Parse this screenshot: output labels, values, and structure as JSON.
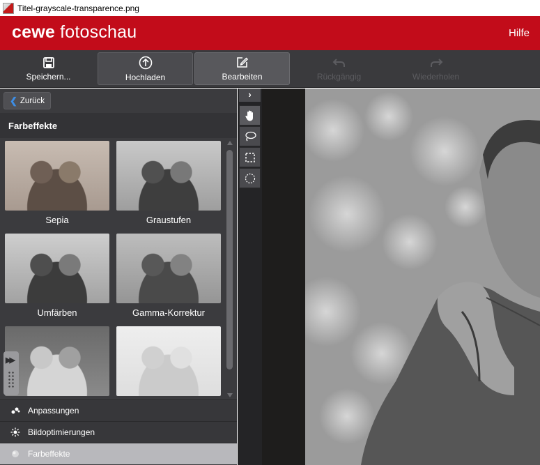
{
  "window": {
    "title": "Titel-grayscale-transparence.png"
  },
  "brand": {
    "logo_bold": "cewe",
    "logo_light": " fotoschau",
    "help": "Hilfe"
  },
  "toolbar": {
    "save": "Speichern...",
    "upload": "Hochladen",
    "edit": "Bearbeiten",
    "undo": "Rückgängig",
    "redo": "Wiederholen"
  },
  "sidebar": {
    "back": "Zurück",
    "section_title": "Farbeffekte",
    "effects": [
      "Sepia",
      "Graustufen",
      "Umfärben",
      "Gamma-Korrektur"
    ],
    "accordion": [
      "Anpassungen",
      "Bildoptimierungen",
      "Farbeffekte"
    ],
    "selected_accordion": "Farbeffekte"
  },
  "tools": [
    "hand-icon",
    "lasso-icon",
    "rectangle-select-icon",
    "ellipse-select-icon"
  ],
  "colors": {
    "brand_red": "#c20c1a",
    "toolbar": "#3a3a3d",
    "accent_blue": "#3d8ee6"
  }
}
